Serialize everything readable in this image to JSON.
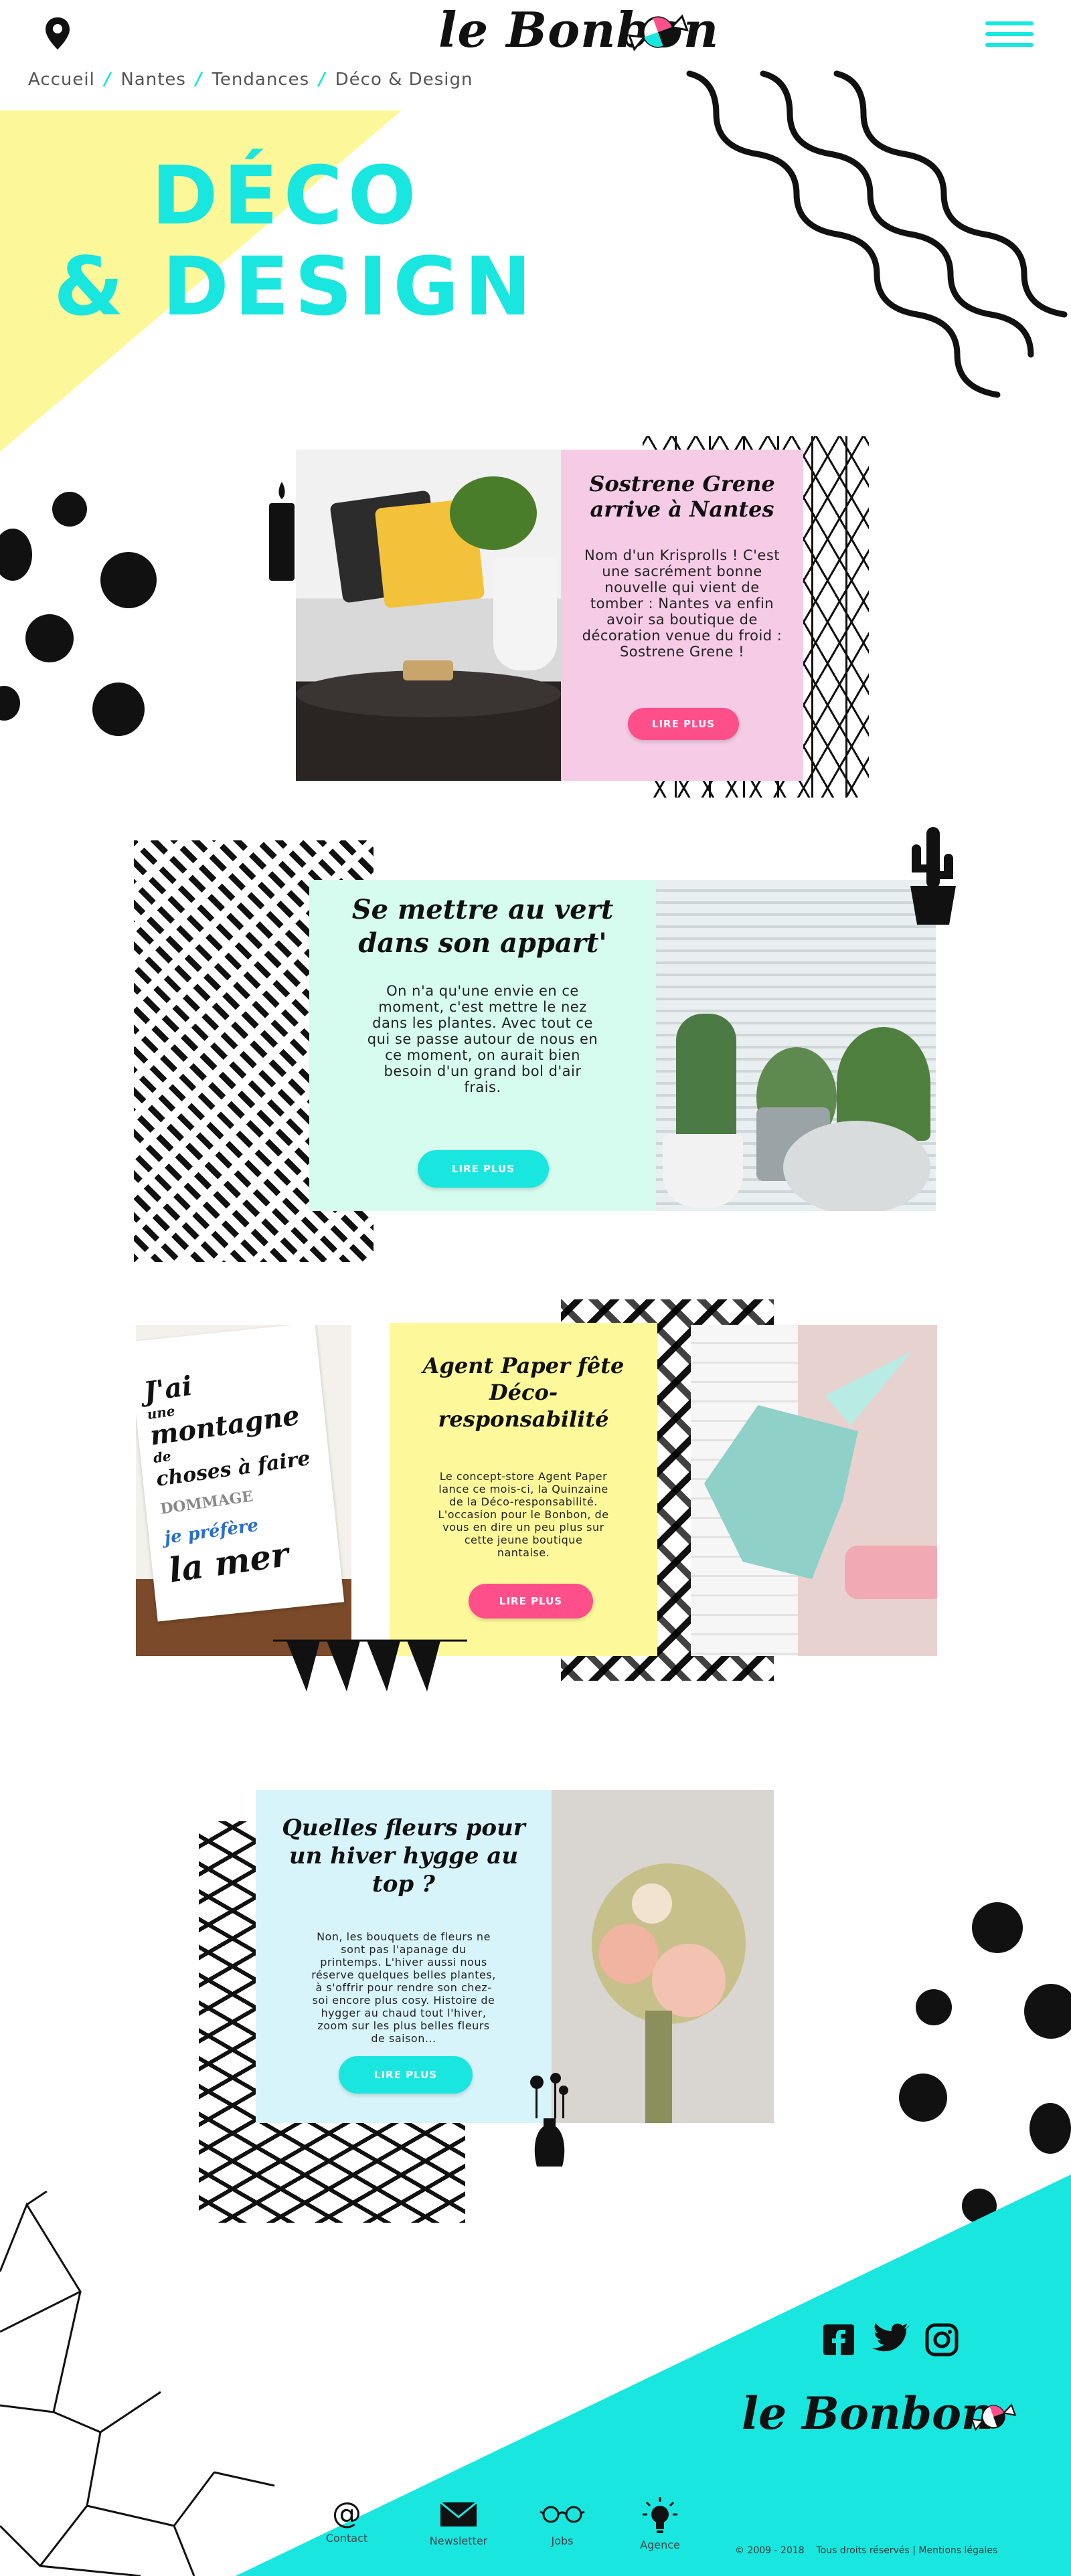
{
  "header": {
    "logo": "le Bonbon",
    "menu_icon": "hamburger-icon",
    "location_icon": "map-pin-icon"
  },
  "breadcrumb": {
    "items": [
      "Accueil",
      "Nantes",
      "Tendances",
      "Déco & Design"
    ]
  },
  "hero": {
    "line1": "DÉCO",
    "line2": "& DESIGN"
  },
  "articles": [
    {
      "title": "Sostrene Grene arrive à Nantes",
      "text": "Nom d'un Krisprolls ! C'est une sacrément bonne nouvelle qui vient de tomber : Nantes va enfin avoir sa boutique de décoration venue du froid : Sostrene Grene !",
      "button": "LIRE PLUS",
      "bg": "#f5cbe6",
      "btn_color": "#ff4f8b"
    },
    {
      "title": "Se mettre au vert dans son appart'",
      "text": "On n'a qu'une envie en ce moment, c'est mettre le nez dans les plantes. Avec tout ce qui se passe autour de nous en ce moment, on aurait bien besoin d'un grand bol d'air frais.",
      "button": "LIRE PLUS",
      "bg": "#d6fbef",
      "btn_color": "#19e6df"
    },
    {
      "title": "Agent Paper fête Déco-responsabilité",
      "text": "Le concept-store Agent Paper lance ce mois-ci, la Quinzaine de la Déco-responsabilité. L'occasion pour le Bonbon, de vous en dire un peu plus sur cette jeune boutique nantaise.",
      "button": "LIRE PLUS",
      "bg": "#fdf99a",
      "btn_color": "#ff4f8b"
    },
    {
      "title": "Quelles fleurs pour un hiver hygge au top ?",
      "text": "Non, les bouquets de fleurs ne sont pas l'apanage du printemps. L'hiver aussi nous réserve quelques belles plantes, à s'offrir pour rendre son chez-soi encore plus cosy. Histoire de hygger au chaud tout l'hiver, zoom sur les plus belles fleurs de saison...",
      "button": "LIRE PLUS",
      "bg": "#d7f4fb",
      "btn_color": "#19e6df"
    }
  ],
  "poster_text": [
    "J'ai",
    "une",
    "montagne",
    "de",
    "choses à faire",
    "DOMMAGE",
    "je préfère",
    "la mer"
  ],
  "footer": {
    "logo": "le Bonbon",
    "social": [
      "facebook-icon",
      "twitter-icon",
      "instagram-icon"
    ],
    "nav": [
      {
        "label": "Contact",
        "icon": "at-icon"
      },
      {
        "label": "Newsletter",
        "icon": "envelope-icon"
      },
      {
        "label": "Jobs",
        "icon": "glasses-icon"
      },
      {
        "label": "Agence",
        "icon": "lightbulb-icon"
      }
    ],
    "copyright": "© 2009 - 2018    Tous droits réservés | Mentions légales"
  },
  "colors": {
    "cyan": "#19e6df",
    "yellow": "#fcf89a",
    "pink": "#ff4f8b"
  }
}
